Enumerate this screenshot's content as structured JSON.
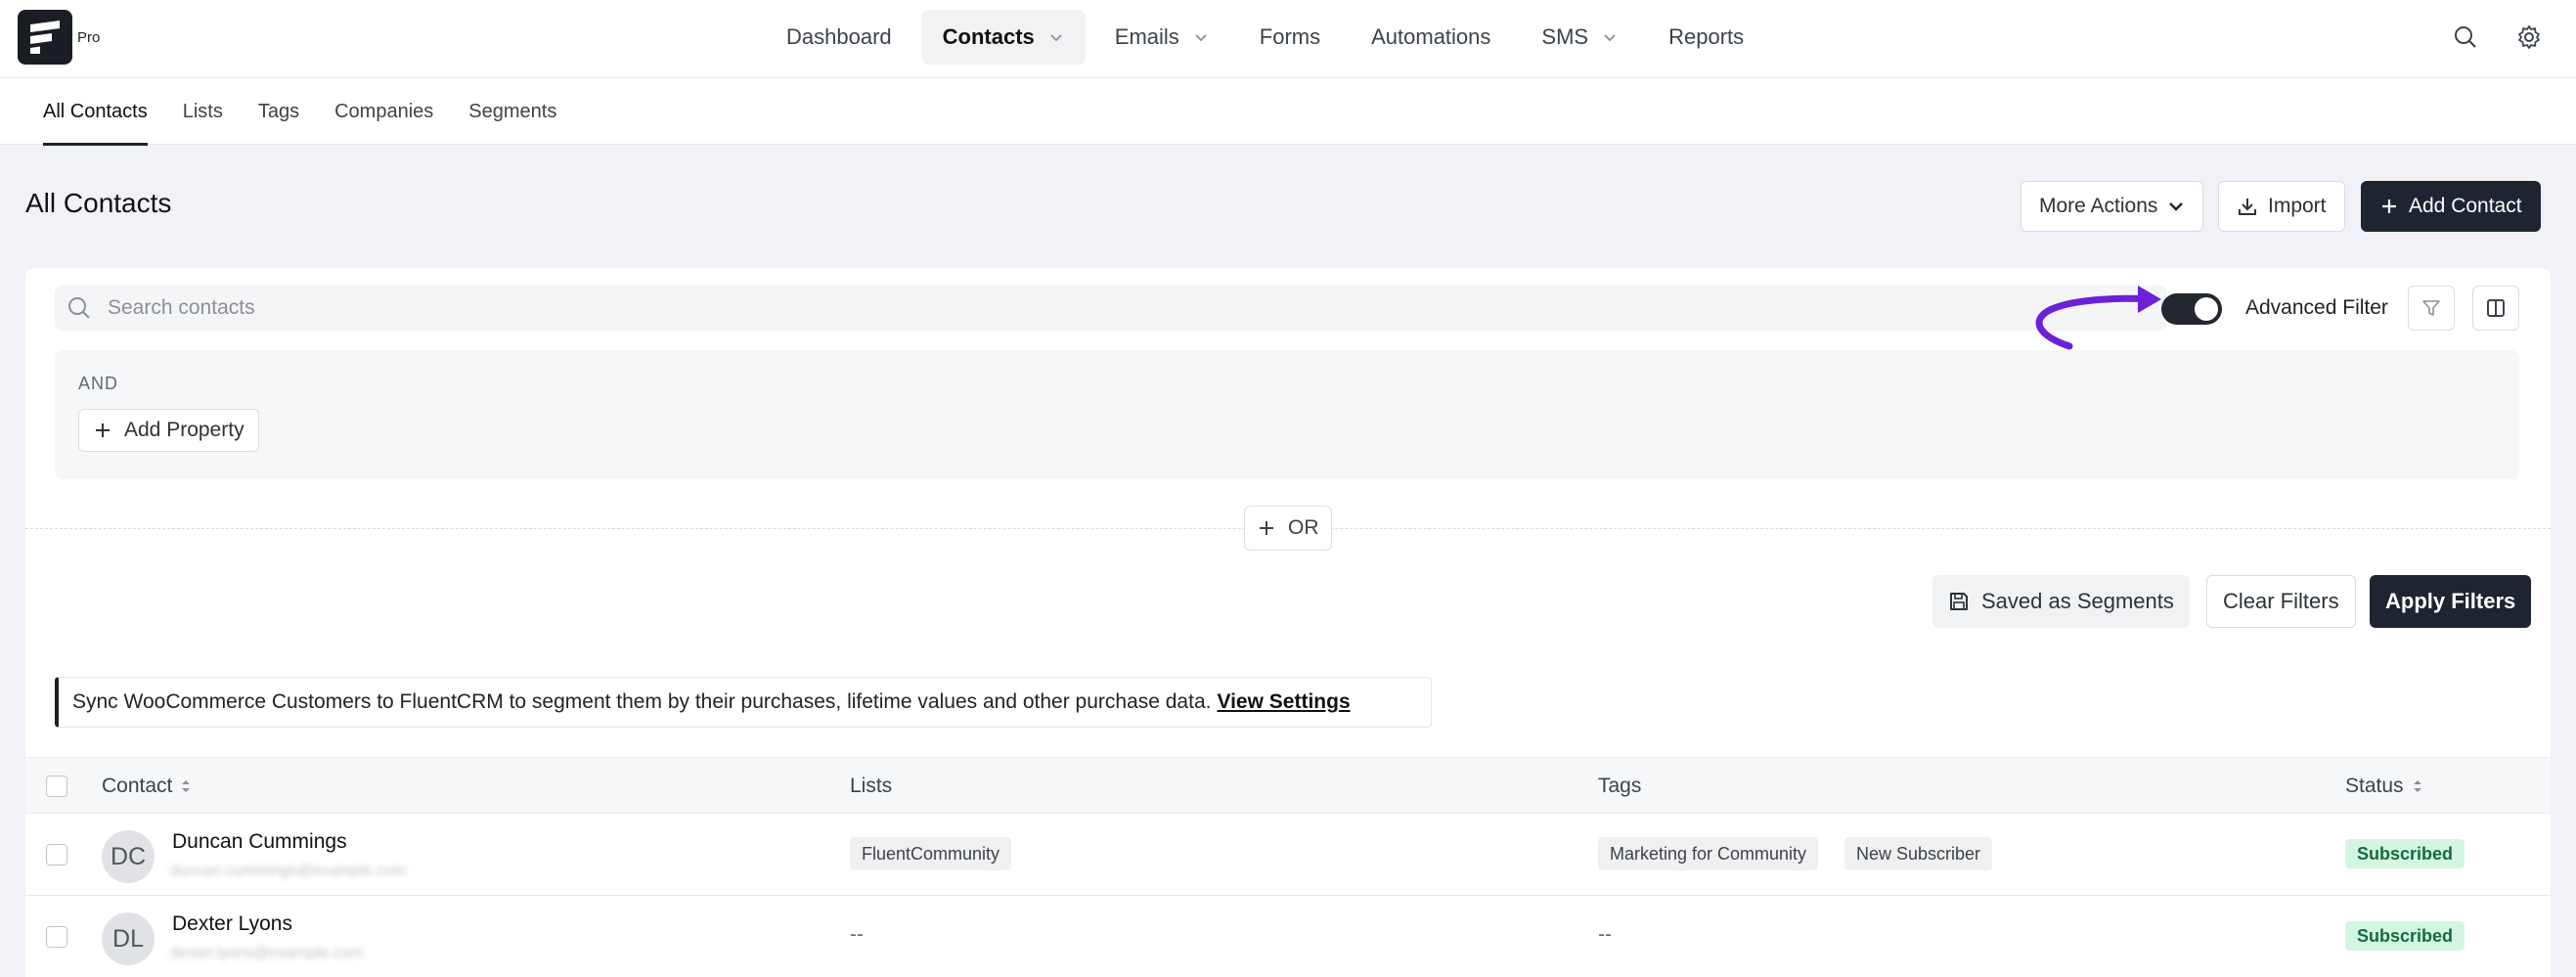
{
  "brand": {
    "pro_label": "Pro"
  },
  "nav": [
    {
      "label": "Dashboard",
      "active": false,
      "dropdown": false
    },
    {
      "label": "Contacts",
      "active": true,
      "dropdown": true
    },
    {
      "label": "Emails",
      "active": false,
      "dropdown": true
    },
    {
      "label": "Forms",
      "active": false,
      "dropdown": false
    },
    {
      "label": "Automations",
      "active": false,
      "dropdown": false
    },
    {
      "label": "SMS",
      "active": false,
      "dropdown": true
    },
    {
      "label": "Reports",
      "active": false,
      "dropdown": false
    }
  ],
  "subtabs": [
    "All Contacts",
    "Lists",
    "Tags",
    "Companies",
    "Segments"
  ],
  "page": {
    "title": "All Contacts",
    "more_actions": "More Actions",
    "import": "Import",
    "add_contact": "Add Contact"
  },
  "filters": {
    "search_placeholder": "Search contacts",
    "advanced_filter_label": "Advanced Filter",
    "advanced_filter_on": true,
    "group_operator": "AND",
    "add_property": "Add Property",
    "or_button": "OR",
    "saved_as_segments": "Saved as Segments",
    "clear_filters": "Clear Filters",
    "apply_filters": "Apply Filters"
  },
  "notice": {
    "text": "Sync WooCommerce Customers to FluentCRM to segment them by their purchases, lifetime values and other purchase data.",
    "link": "View Settings"
  },
  "table": {
    "columns": [
      "Contact",
      "Lists",
      "Tags",
      "Status"
    ],
    "rows": [
      {
        "initials": "DC",
        "name": "Duncan Cummings",
        "email": "duncan.cummings@example.com",
        "lists": [
          "FluentCommunity"
        ],
        "tags": [
          "Marketing for Community",
          "New Subscriber"
        ],
        "status": "Subscribed"
      },
      {
        "initials": "DL",
        "name": "Dexter Lyons",
        "email": "dexter.lyons@example.com",
        "lists_empty": "--",
        "tags_empty": "--",
        "status": "Subscribed"
      }
    ]
  },
  "colors": {
    "accent_dark": "#1e2530",
    "annotation_arrow": "#6b21d6",
    "status_bg": "#d5f5e3",
    "status_text": "#146c3a"
  },
  "icons": [
    "search-icon",
    "gear-icon",
    "chevron-down-icon",
    "download-icon",
    "plus-icon",
    "filter-icon",
    "columns-icon",
    "save-icon",
    "sort-icon"
  ]
}
